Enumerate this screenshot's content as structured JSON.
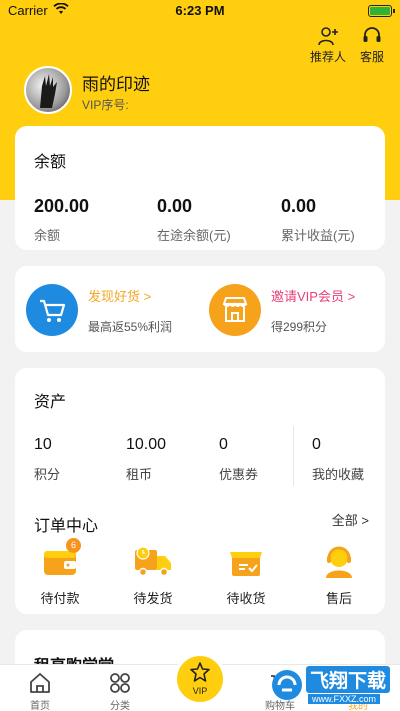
{
  "status_bar": {
    "carrier": "Carrier",
    "time": "6:23 PM"
  },
  "header": {
    "referrer_label": "推荐人",
    "service_label": "客服",
    "username": "雨的印迹",
    "vip_number_label": "VIP序号:"
  },
  "balance": {
    "title": "余额",
    "stats": [
      {
        "value": "200.00",
        "label": "余额"
      },
      {
        "value": "0.00",
        "label": "在途余额(元)"
      },
      {
        "value": "0.00",
        "label": "累计收益(元)"
      }
    ]
  },
  "promos": [
    {
      "title": "发现好货 >",
      "subtitle": "最高返55%利润",
      "color": "#f5a623",
      "bg": "#1f8be0"
    },
    {
      "title": "邀请VIP会员 >",
      "subtitle": "得299积分",
      "color": "#e8407a",
      "bg": "#f7a21b"
    }
  ],
  "assets": {
    "title": "资产",
    "items": [
      {
        "value": "10",
        "label": "积分"
      },
      {
        "value": "10.00",
        "label": "租币"
      },
      {
        "value": "0",
        "label": "优惠券"
      },
      {
        "value": "0",
        "label": "我的收藏"
      }
    ]
  },
  "orders": {
    "title": "订单中心",
    "all_label": "全部 >",
    "items": [
      {
        "label": "待付款",
        "badge": "6",
        "icon": "wallet-icon"
      },
      {
        "label": "待发货",
        "icon": "truck-icon"
      },
      {
        "label": "待收货",
        "icon": "package-icon"
      },
      {
        "label": "售后",
        "icon": "service-agent-icon"
      }
    ]
  },
  "school": {
    "title": "租享购学堂"
  },
  "tabbar": {
    "tabs": [
      {
        "label": "首页",
        "icon": "home-icon"
      },
      {
        "label": "分类",
        "icon": "grid-icon"
      },
      {
        "label": "VIP",
        "icon": "vip-icon"
      },
      {
        "label": "购物车",
        "icon": "cart-icon"
      },
      {
        "label": "我的",
        "icon": "user-icon"
      }
    ]
  },
  "watermark": {
    "text": "飞翔下载",
    "url": "www.FXXZ.com"
  },
  "colors": {
    "brand_yellow": "#ffcf0f",
    "accent_blue": "#1f8be0",
    "accent_orange": "#f7a21b",
    "accent_pink": "#e8407a"
  }
}
